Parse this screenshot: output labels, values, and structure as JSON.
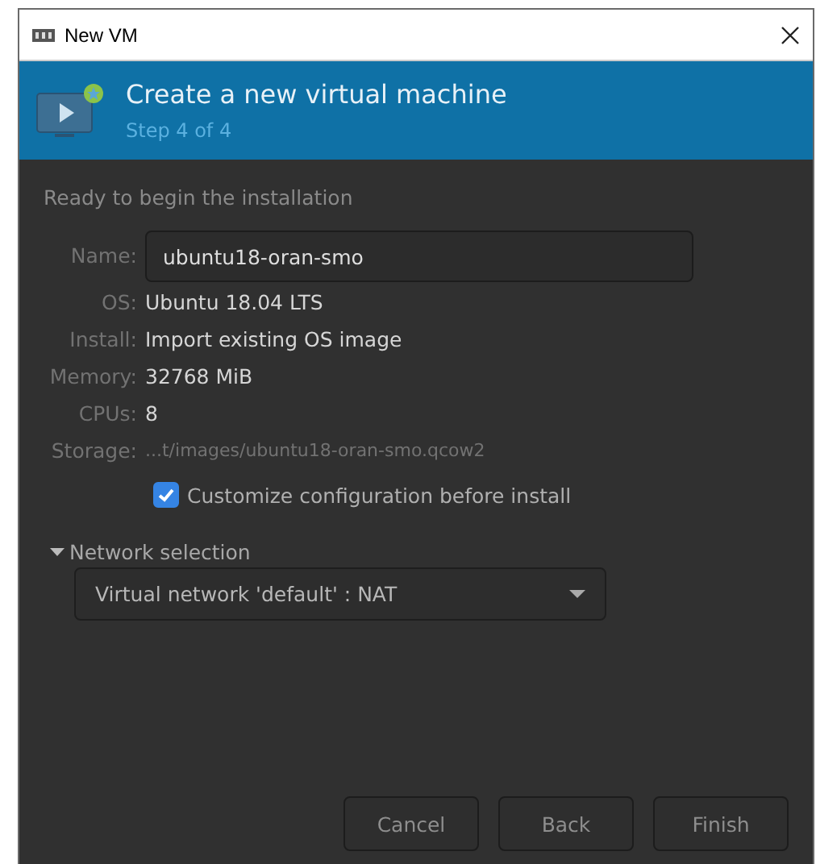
{
  "window": {
    "title": "New VM"
  },
  "header": {
    "title": "Create a new virtual machine",
    "subtitle": "Step 4 of 4"
  },
  "intro": "Ready to begin the installation",
  "details": [
    {
      "label": "Name:",
      "value": "ubuntu18-oran-smo",
      "kind": "entry"
    },
    {
      "label": "OS:",
      "value": "Ubuntu 18.04 LTS",
      "kind": "text"
    },
    {
      "label": "Install:",
      "value": "Import existing OS image",
      "kind": "text"
    },
    {
      "label": "Memory:",
      "value": "32768 MiB",
      "kind": "text"
    },
    {
      "label": "CPUs:",
      "value": "8",
      "kind": "text"
    },
    {
      "label": "Storage:",
      "value": "...t/images/ubuntu18-oran-smo.qcow2",
      "kind": "dim"
    }
  ],
  "customize": {
    "label": "Customize configuration before install",
    "checked": true
  },
  "network": {
    "label": "Network selection",
    "expanded": true,
    "value": "Virtual network 'default' : NAT"
  },
  "buttons": [
    "Cancel",
    "Back",
    "Finish"
  ]
}
